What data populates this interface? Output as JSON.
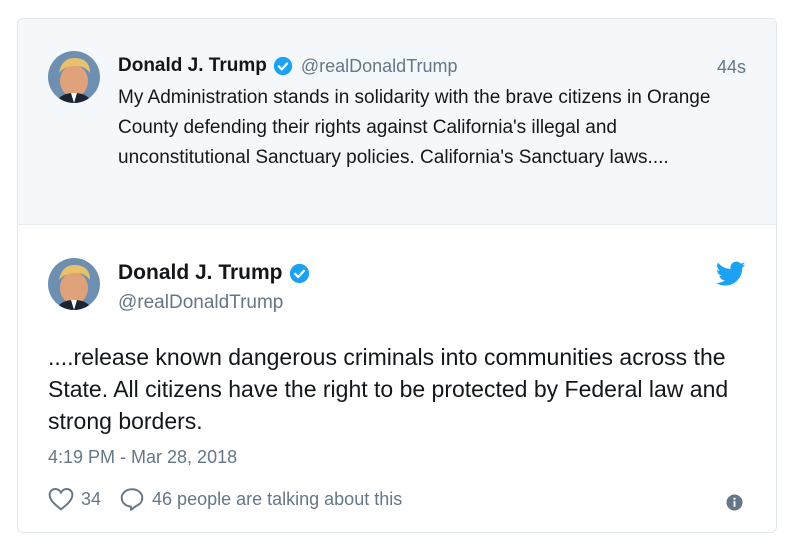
{
  "parent_tweet": {
    "author_name": "Donald J. Trump",
    "handle": "@realDonaldTrump",
    "time": "44s",
    "text": "My Administration stands in solidarity with the brave citizens in Orange County defending their rights against California's illegal and unconstitutional Sanctuary policies. California's Sanctuary laws...."
  },
  "main_tweet": {
    "author_name": "Donald J. Trump",
    "handle": "@realDonaldTrump",
    "text": "....release known dangerous criminals into communities across the State. All citizens have the right to be protected by Federal law and strong borders.",
    "timestamp": "4:19 PM - Mar 28, 2018",
    "like_count": "34",
    "talking_label": "46 people are talking about this"
  },
  "colors": {
    "verified": "#1da1f2",
    "twitter_blue": "#1da1f2",
    "muted": "#657786",
    "parent_bg": "#f5f8fa"
  },
  "icons": {
    "verified": "verified-badge-icon",
    "bird": "twitter-bird-icon",
    "like": "heart-icon",
    "reply": "speech-bubble-icon",
    "info": "info-icon"
  }
}
